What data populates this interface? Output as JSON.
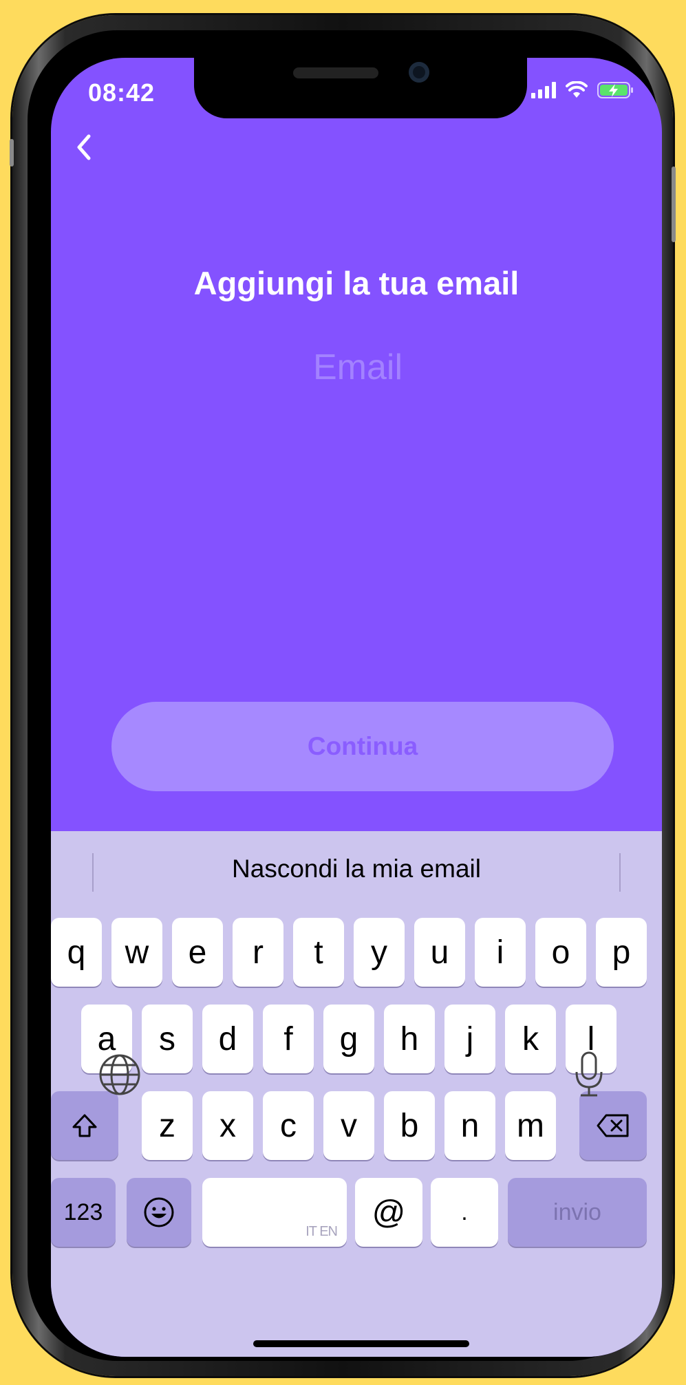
{
  "status_bar": {
    "time": "08:42"
  },
  "header": {
    "title": "Aggiungi la tua email"
  },
  "email": {
    "placeholder": "Email",
    "value": ""
  },
  "continue_button": {
    "label": "Continua"
  },
  "keyboard": {
    "suggestion": "Nascondi la mia email",
    "row1": [
      "q",
      "w",
      "e",
      "r",
      "t",
      "y",
      "u",
      "i",
      "o",
      "p"
    ],
    "row2": [
      "a",
      "s",
      "d",
      "f",
      "g",
      "h",
      "j",
      "k",
      "l"
    ],
    "row3": [
      "z",
      "x",
      "c",
      "v",
      "b",
      "n",
      "m"
    ],
    "numbers_label": "123",
    "space_hint": "IT EN",
    "at_label": "@",
    "dot_label": ".",
    "return_label": "invio"
  },
  "colors": {
    "background": "#FEDB5D",
    "screen": "#8452FF",
    "button": "#A689FF",
    "keyboard": "#CCC5EE"
  },
  "icons": [
    "back-icon",
    "signal-icon",
    "wifi-icon",
    "battery-charging-icon",
    "shift-icon",
    "backspace-icon",
    "emoji-icon",
    "globe-icon",
    "microphone-icon"
  ]
}
